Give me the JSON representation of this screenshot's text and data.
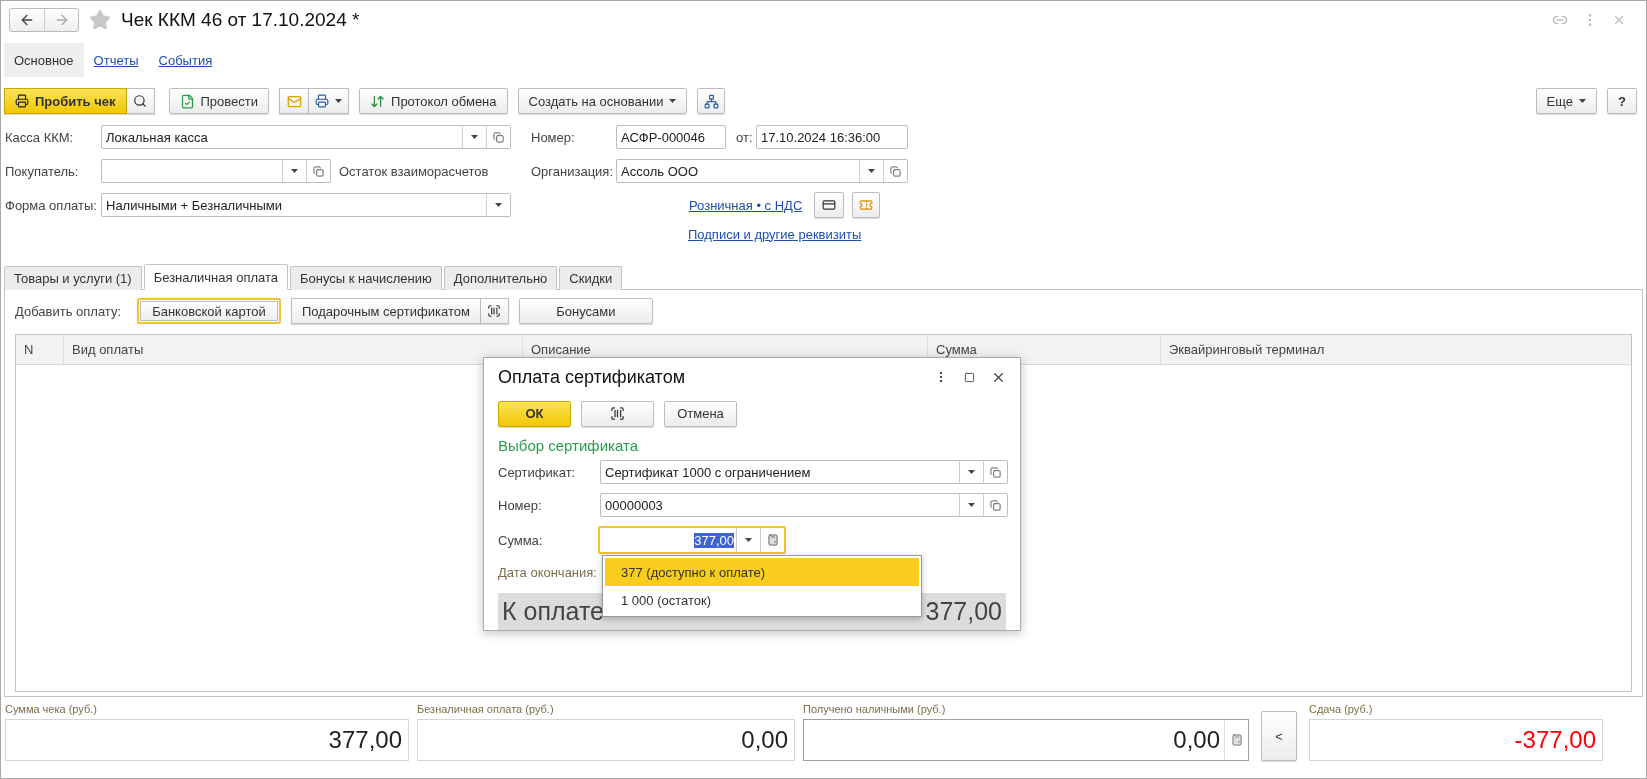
{
  "window": {
    "title": "Чек ККМ 46 от 17.10.2024 *"
  },
  "nav_tabs": [
    {
      "label": "Основное",
      "selected": true
    },
    {
      "label": "Отчеты",
      "selected": false
    },
    {
      "label": "События",
      "selected": false
    }
  ],
  "toolbar": {
    "print_receipt": "Пробить чек",
    "post": "Провести",
    "exchange_log": "Протокол обмена",
    "create_based_on": "Создать на основании",
    "more": "Еще",
    "help": "?"
  },
  "fields": {
    "cash_register": {
      "label": "Касса ККМ:",
      "value": "Локальная касса"
    },
    "buyer": {
      "label": "Покупатель:"
    },
    "balance_label": "Остаток взаиморасчетов",
    "payment_form": {
      "label": "Форма оплаты:",
      "value": "Наличными + Безналичными"
    },
    "number": {
      "label": "Номер:",
      "value": "АСФР-000046"
    },
    "date": {
      "label": "от:",
      "value": "17.10.2024 16:36:00"
    },
    "organization": {
      "label": "Организация:",
      "value": "Ассоль ООО"
    },
    "price_type_link": "Розничная • с НДС",
    "signatures_link": "Подписи и другие реквизиты"
  },
  "tabs": [
    {
      "label": "Товары и услуги (1)",
      "selected": false
    },
    {
      "label": "Безналичная оплата",
      "selected": true
    },
    {
      "label": "Бонусы к начислению",
      "selected": false
    },
    {
      "label": "Дополнительно",
      "selected": false
    },
    {
      "label": "Скидки",
      "selected": false
    }
  ],
  "add_payment": {
    "label": "Добавить оплату:",
    "buttons": [
      {
        "label": "Банковской картой",
        "kind": "plain",
        "focused": true
      },
      {
        "label": "Подарочным сертификатом",
        "kind": "with_barcode",
        "focused": false
      },
      {
        "label": "Бонусами",
        "kind": "plain",
        "focused": false
      }
    ]
  },
  "table": {
    "columns": [
      "N",
      "Вид оплаты",
      "Описание",
      "Сумма",
      "Эквайринговый терминал"
    ]
  },
  "dialog": {
    "title": "Оплата сертификатом",
    "ok": "ОК",
    "cancel": "Отмена",
    "section": "Выбор сертификата",
    "certificate": {
      "label": "Сертификат:",
      "value": "Сертификат 1000 с ограничением"
    },
    "number": {
      "label": "Номер:",
      "value": "00000003"
    },
    "amount": {
      "label": "Сумма:",
      "value": "377,00",
      "highlighted": true
    },
    "end_date_label": "Дата окончания:",
    "due_label": "К оплате",
    "due_value": "377,00",
    "dropdown": [
      {
        "label": "377 (доступно к оплате)",
        "selected": true
      },
      {
        "label": "1 000 (остаток)",
        "selected": false
      }
    ]
  },
  "totals": [
    {
      "label": "Сумма чека (руб.)",
      "value": "377,00",
      "kind": "readonly",
      "negative": false
    },
    {
      "label": "Безналичная оплата (руб.)",
      "value": "0,00",
      "kind": "readonly",
      "negative": false
    },
    {
      "label": "Получено наличными (руб.)",
      "value": "0,00",
      "kind": "editable",
      "negative": false
    },
    {
      "label": "Сдача (руб.)",
      "value": "-377,00",
      "kind": "readonly",
      "negative": true
    }
  ],
  "move_button": "<"
}
